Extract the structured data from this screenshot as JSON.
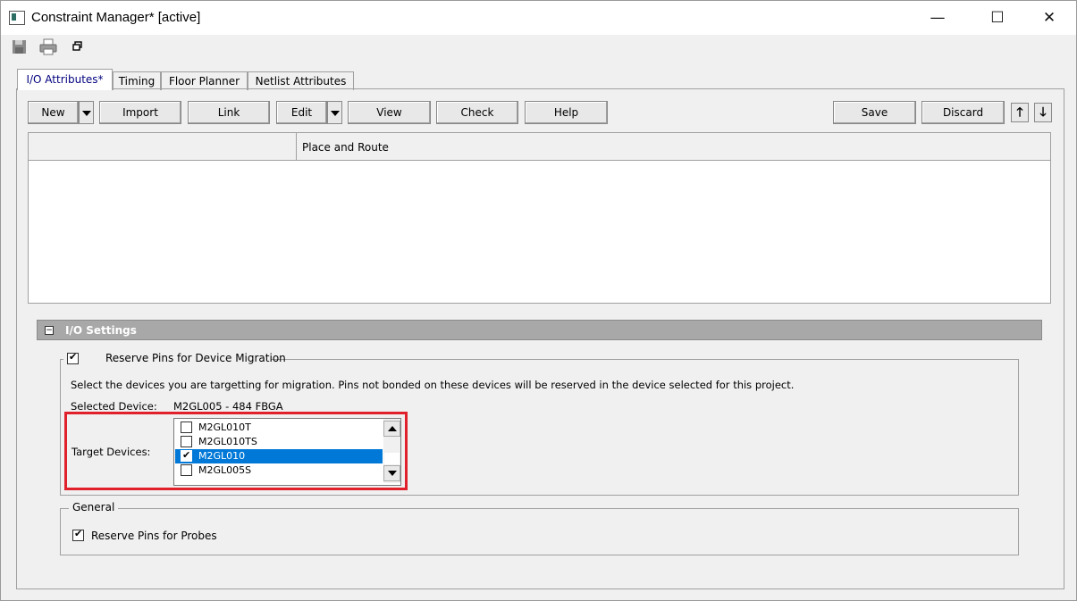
{
  "window": {
    "title": "Constraint Manager* [active]",
    "controls": {
      "minimize": "—",
      "maximize": "☐",
      "close": "✕"
    }
  },
  "toolbar": {
    "icons": [
      "save-icon",
      "print-icon",
      "restore-window-icon"
    ]
  },
  "tabs": [
    {
      "label": "I/O Attributes*",
      "active": true
    },
    {
      "label": "Timing",
      "active": false
    },
    {
      "label": "Floor Planner",
      "active": false
    },
    {
      "label": "Netlist Attributes",
      "active": false
    }
  ],
  "actions": {
    "new": "New",
    "import": "Import",
    "link": "Link",
    "edit": "Edit",
    "view": "View",
    "check": "Check",
    "help": "Help",
    "save": "Save",
    "discard": "Discard",
    "move_up": "🡑",
    "move_down": "🡓"
  },
  "grid": {
    "columns": [
      "",
      "Place and Route"
    ]
  },
  "io_settings": {
    "title": "I/O Settings",
    "reserve_migration": {
      "label": "Reserve Pins for Device Migration",
      "checked": true
    },
    "description": "Select the devices you are targetting for migration. Pins not bonded on these devices will be reserved in the device selected for this project.",
    "selected_device_label": "Selected Device:",
    "selected_device_value": "M2GL005 - 484 FBGA",
    "target_devices_label": "Target Devices:",
    "target_devices": [
      {
        "name": "M2GL010T",
        "checked": false,
        "selected": false
      },
      {
        "name": "M2GL010TS",
        "checked": false,
        "selected": false
      },
      {
        "name": "M2GL010",
        "checked": true,
        "selected": true
      },
      {
        "name": "M2GL005S",
        "checked": false,
        "selected": false
      }
    ]
  },
  "general": {
    "title": "General",
    "reserve_probes": {
      "label": "Reserve Pins for Probes",
      "checked": true
    }
  }
}
